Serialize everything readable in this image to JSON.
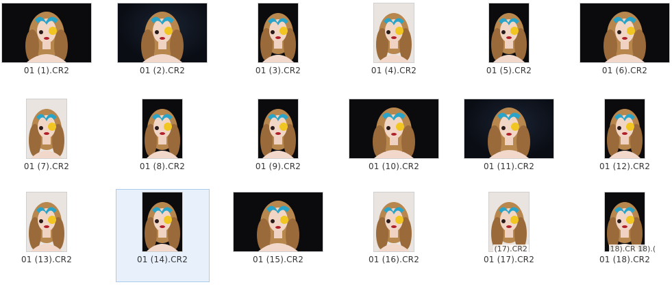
{
  "files": [
    {
      "name": "01 (1).CR2",
      "orientation": "landscape",
      "bg": "dark",
      "selected": false
    },
    {
      "name": "01 (2).CR2",
      "orientation": "landscape",
      "bg": "darkblue",
      "selected": false
    },
    {
      "name": "01 (3).CR2",
      "orientation": "portrait",
      "bg": "dark",
      "selected": false
    },
    {
      "name": "01 (4).CR2",
      "orientation": "portrait",
      "bg": "light",
      "selected": false
    },
    {
      "name": "01 (5).CR2",
      "orientation": "portrait",
      "bg": "dark",
      "selected": false
    },
    {
      "name": "01 (6).CR2",
      "orientation": "landscape",
      "bg": "dark",
      "selected": false
    },
    {
      "name": "01 (7).CR2",
      "orientation": "portrait",
      "bg": "light",
      "selected": false
    },
    {
      "name": "01 (8).CR2",
      "orientation": "portrait",
      "bg": "dark",
      "selected": false
    },
    {
      "name": "01 (9).CR2",
      "orientation": "portrait",
      "bg": "dark",
      "selected": false
    },
    {
      "name": "01 (10).CR2",
      "orientation": "landscape",
      "bg": "dark",
      "selected": false
    },
    {
      "name": "01 (11).CR2",
      "orientation": "landscape",
      "bg": "darkblue",
      "selected": false
    },
    {
      "name": "01 (12).CR2",
      "orientation": "portrait",
      "bg": "dark",
      "selected": false
    },
    {
      "name": "01 (13).CR2",
      "orientation": "portrait",
      "bg": "light",
      "selected": false
    },
    {
      "name": "01 (14).CR2",
      "orientation": "portrait",
      "bg": "dark",
      "selected": true
    },
    {
      "name": "01 (15).CR2",
      "orientation": "landscape",
      "bg": "dark",
      "selected": false
    },
    {
      "name": "01 (16).CR2",
      "orientation": "portrait",
      "bg": "light",
      "selected": false
    },
    {
      "name": "01 (17).CR2",
      "orientation": "portrait",
      "bg": "light",
      "selected": false,
      "overlay": "(17).CR2"
    },
    {
      "name": "01 (18).CR2",
      "orientation": "portrait",
      "bg": "dark",
      "selected": false,
      "overlay": "18).CR  18).("
    }
  ],
  "colors": {
    "selection_bg": "#e8f1fb",
    "selection_border": "#a9cbee",
    "label_text": "#333333"
  }
}
